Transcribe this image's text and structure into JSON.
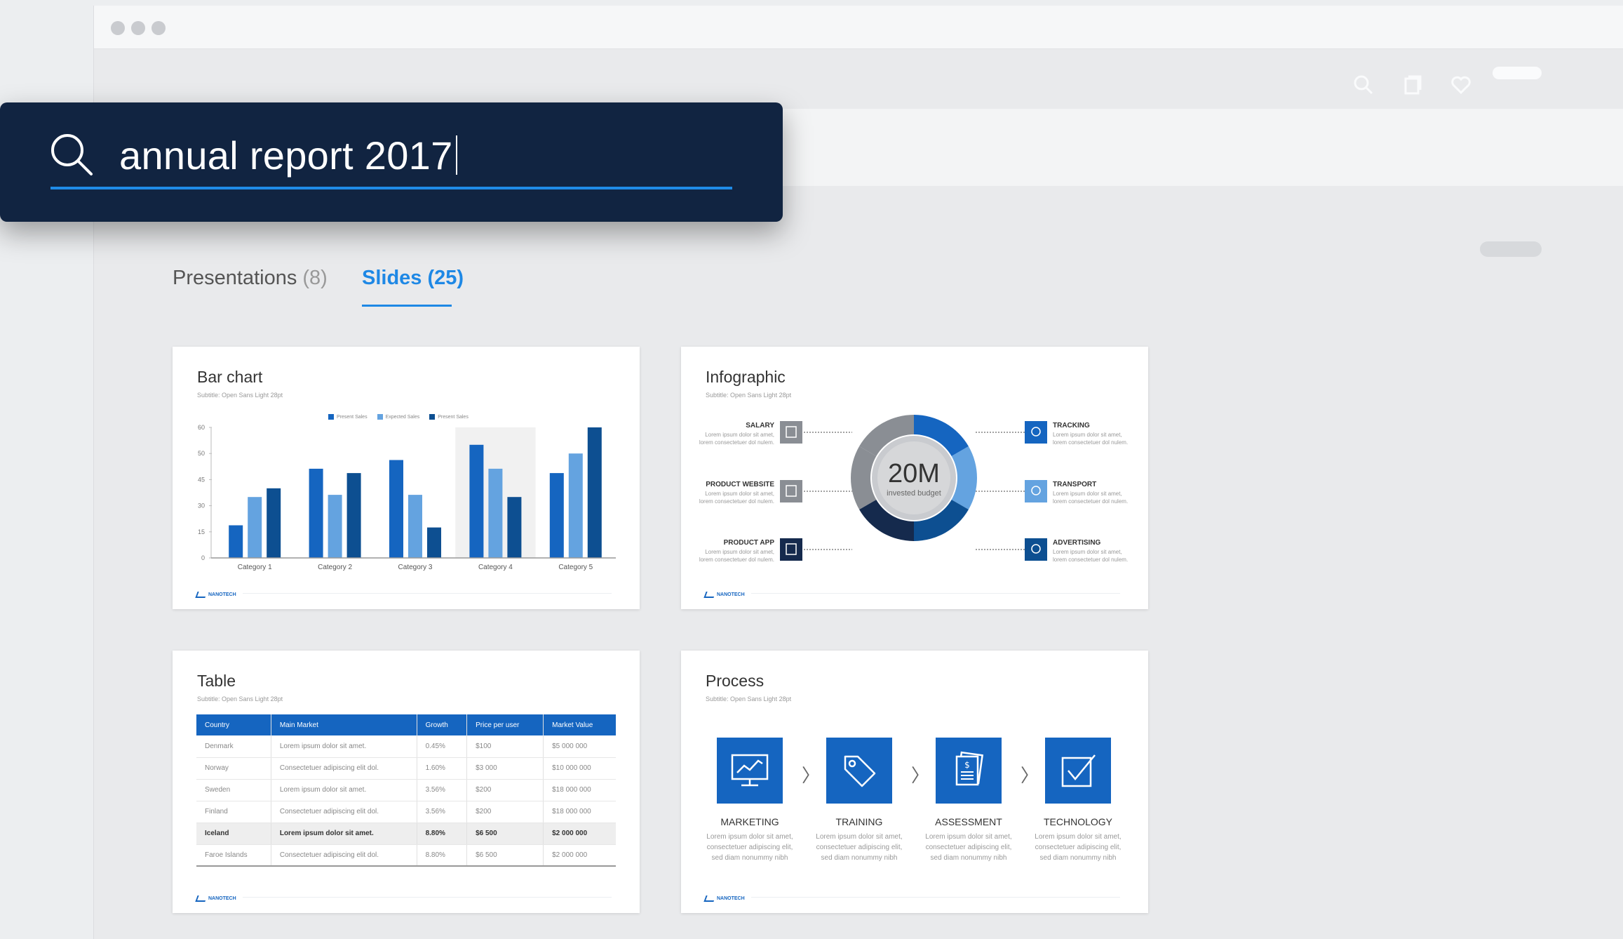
{
  "search": {
    "query": "annual report 2017"
  },
  "tabs": [
    {
      "label": "Presentations",
      "count": "(8)"
    },
    {
      "label": "Slides (25)"
    }
  ],
  "slides": {
    "bar_chart": {
      "title": "Bar chart",
      "subtitle": "Subtitle: Open Sans Light 28pt",
      "legend": [
        "Present Sales",
        "Expected Sales",
        "Present Sales"
      ],
      "logo": "NANOTECH",
      "chart_data": {
        "type": "bar",
        "categories": [
          "Category 1",
          "Category 2",
          "Category 3",
          "Category 4",
          "Category 5"
        ],
        "series": [
          {
            "name": "Present Sales",
            "values": [
              15,
              41,
              45,
              52,
              39
            ],
            "color": "#1565c0"
          },
          {
            "name": "Expected Sales",
            "values": [
              28,
              29,
              29,
              41,
              48
            ],
            "color": "#64a3e0"
          },
          {
            "name": "Present Sales",
            "values": [
              32,
              39,
              14,
              28,
              60
            ],
            "color": "#0d4f91"
          }
        ],
        "yticks": [
          "0",
          "15",
          "30",
          "45",
          "50",
          "60"
        ],
        "ylim": [
          0,
          60
        ],
        "highlight_category": "Category 4"
      }
    },
    "infographic": {
      "title": "Infographic",
      "subtitle": "Subtitle: Open Sans Light 28pt",
      "center_value": "20M",
      "center_label": "invested budget",
      "logo": "NANOTECH",
      "left_items": [
        {
          "label": "SALARY",
          "text1": "Lorem ipsum dolor sit amet,",
          "text2": "lorem consectetuer dol nulem.",
          "icon": "person-icon",
          "color": "#8a8e94"
        },
        {
          "label": "PRODUCT WEBSITE",
          "text1": "Lorem ipsum dolor sit amet,",
          "text2": "lorem consectetuer dol nulem.",
          "icon": "laptop-icon",
          "color": "#8a8e94"
        },
        {
          "label": "PRODUCT APP",
          "text1": "Lorem ipsum dolor sit amet,",
          "text2": "lorem consectetuer dol nulem.",
          "icon": "phone-icon",
          "color": "#152a4d"
        }
      ],
      "right_items": [
        {
          "label": "TRACKING",
          "text1": "Lorem ipsum dolor sit amet,",
          "text2": "lorem consectetuer dol nulem.",
          "icon": "location-pin-icon",
          "color": "#1565c0"
        },
        {
          "label": "TRANSPORT",
          "text1": "Lorem ipsum dolor sit amet,",
          "text2": "lorem consectetuer dol nulem.",
          "icon": "truck-icon",
          "color": "#64a3e0"
        },
        {
          "label": "ADVERTISING",
          "text1": "Lorem ipsum dolor sit amet,",
          "text2": "lorem consectetuer dol nulem.",
          "icon": "megaphone-icon",
          "color": "#0d4f91"
        }
      ]
    },
    "table": {
      "title": "Table",
      "subtitle": "Subtitle: Open Sans Light 28pt",
      "logo": "NANOTECH",
      "columns": [
        "Country",
        "Main Market",
        "Growth",
        "Price per user",
        "Market Value"
      ],
      "rows": [
        [
          "Denmark",
          "Lorem ipsum dolor sit amet.",
          "0.45%",
          "$100",
          "$5 000 000"
        ],
        [
          "Norway",
          "Consectetuer adipiscing elit dol.",
          "1.60%",
          "$3 000",
          "$10 000 000"
        ],
        [
          "Sweden",
          "Lorem ipsum dolor sit amet.",
          "3.56%",
          "$200",
          "$18 000 000"
        ],
        [
          "Finland",
          "Consectetuer adipiscing elit dol.",
          "3.56%",
          "$200",
          "$18 000 000"
        ],
        [
          "Iceland",
          "Lorem ipsum dolor sit amet.",
          "8.80%",
          "$6 500",
          "$2 000 000"
        ],
        [
          "Faroe Islands",
          "Consectetuer adipiscing elit dol.",
          "8.80%",
          "$6 500",
          "$2 000 000"
        ]
      ],
      "highlight_row": 4
    },
    "process": {
      "title": "Process",
      "subtitle": "Subtitle: Open Sans Light 28pt",
      "logo": "NANOTECH",
      "steps": [
        {
          "label": "MARKETING",
          "desc": "Lorem ipsum dolor sit amet, consectetuer adipiscing elit, sed diam nonummy nibh",
          "icon": "monitor-chart-icon"
        },
        {
          "label": "TRAINING",
          "desc": "Lorem ipsum dolor sit amet, consectetuer adipiscing elit, sed diam nonummy nibh",
          "icon": "tag-icon"
        },
        {
          "label": "ASSESSMENT",
          "desc": "Lorem ipsum dolor sit amet, consectetuer adipiscing elit, sed diam nonummy nibh",
          "icon": "document-dollar-icon"
        },
        {
          "label": "TECHNOLOGY",
          "desc": "Lorem ipsum dolor sit amet, consectetuer adipiscing elit, sed diam nonummy nibh",
          "icon": "checkbox-icon"
        }
      ],
      "chevron": "〉"
    }
  },
  "colors": {
    "navy": "#112441",
    "accent": "#1e88e5",
    "primary": "#1565c0"
  }
}
